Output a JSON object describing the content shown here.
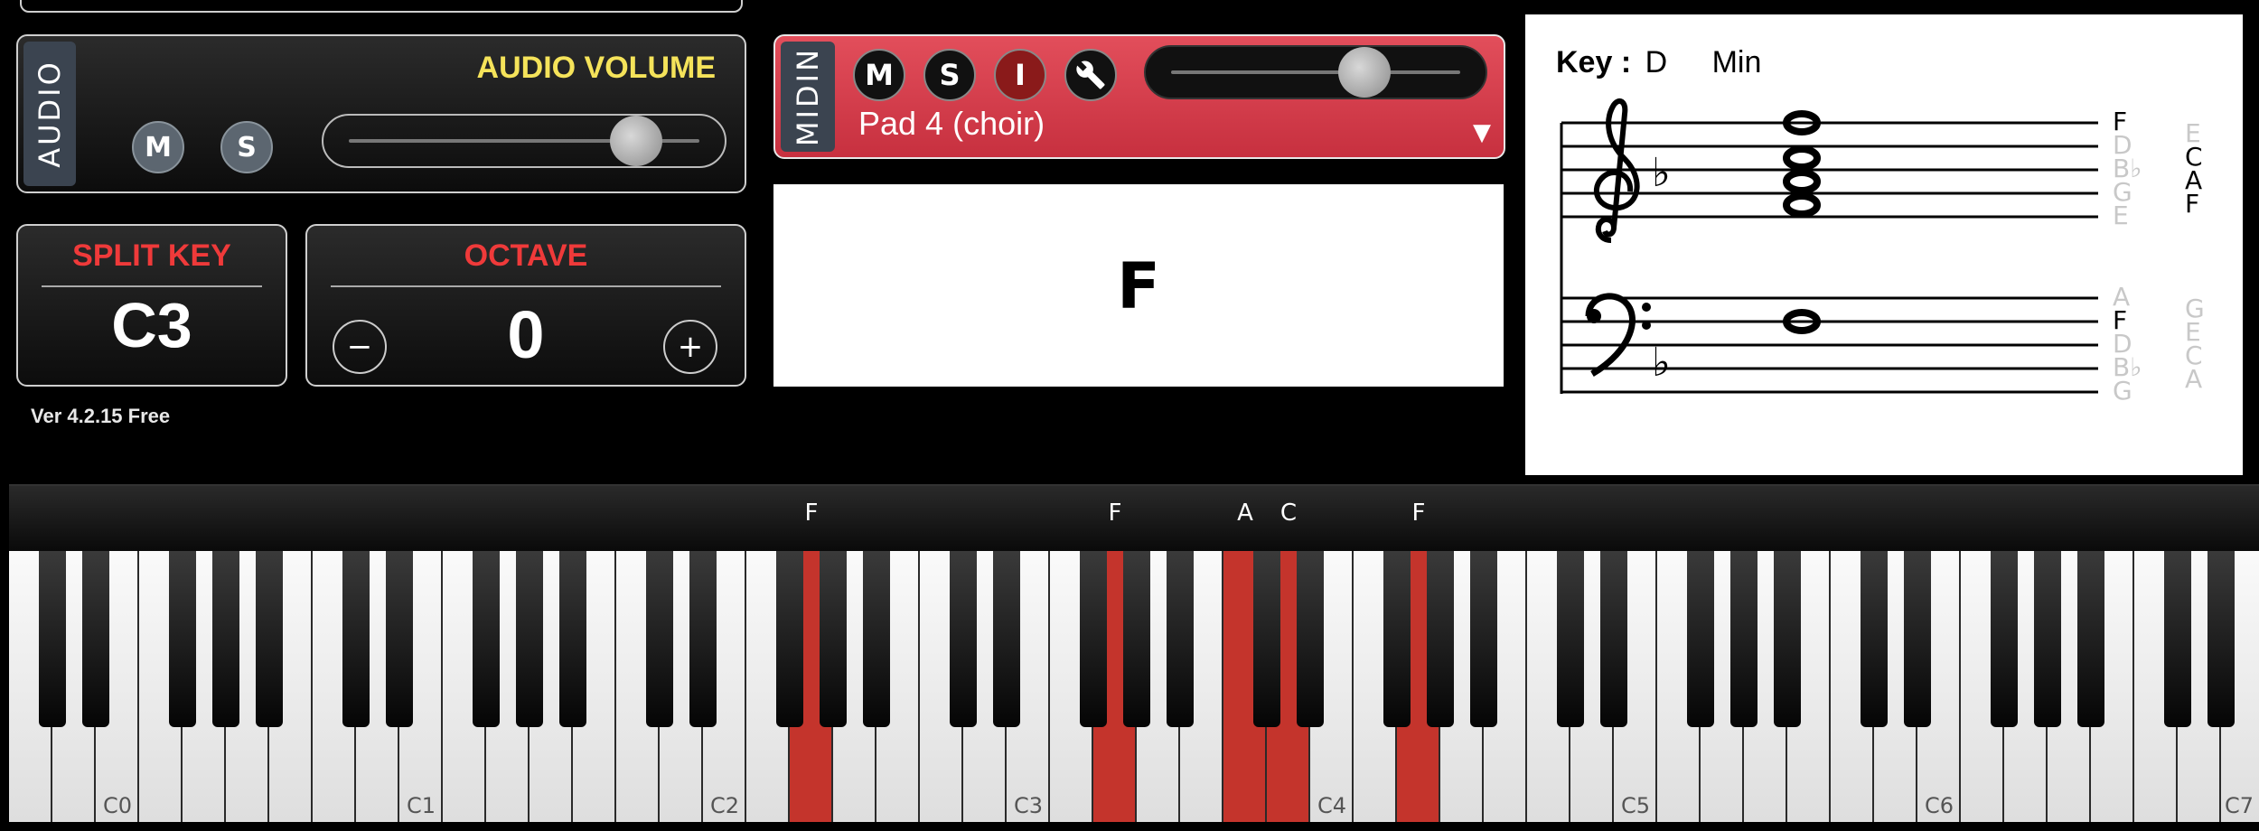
{
  "audio": {
    "tab_label": "AUDIO",
    "title": "AUDIO VOLUME",
    "mute_label": "M",
    "solo_label": "S",
    "volume_fraction": 0.82
  },
  "split_key": {
    "title": "SPLIT KEY",
    "value": "C3"
  },
  "octave": {
    "title": "OCTAVE",
    "value": "0",
    "minus": "−",
    "plus": "+"
  },
  "version": "Ver 4.2.15 Free",
  "midi": {
    "tab_label": "MIDIN",
    "mute_label": "M",
    "solo_label": "S",
    "input_label": "I",
    "instrument": "Pad 4 (choir)",
    "dropdown_arrow": "▼",
    "volume_fraction": 0.67
  },
  "chord_display": {
    "chord": "F"
  },
  "notation": {
    "key_label": "Key :",
    "key_note": "D",
    "key_mode": "Min",
    "treble_flat": "♭",
    "bass_flat": "♭",
    "treble_lines": [
      "F",
      "D",
      "B♭",
      "G",
      "E"
    ],
    "treble_spaces": [
      "E",
      "C",
      "A",
      "F"
    ],
    "treble_active_lines": [
      "F"
    ],
    "treble_active_spaces": [
      "C",
      "A",
      "F"
    ],
    "bass_lines": [
      "A",
      "F",
      "D",
      "B♭",
      "G"
    ],
    "bass_spaces": [
      "G",
      "E",
      "C",
      "A"
    ],
    "bass_active_lines": [
      "F"
    ]
  },
  "keyboard": {
    "octave_labels": [
      "C0",
      "C1",
      "C2",
      "C3",
      "C4",
      "C5",
      "C6",
      "C7"
    ],
    "note_labels": [
      "F",
      "F",
      "A",
      "C",
      "F"
    ],
    "highlight_color": "#c4342c"
  },
  "colors": {
    "audio_title": "#f5e35a",
    "red_title": "#ef3a3a",
    "midi_panel": "#d83a4a"
  }
}
